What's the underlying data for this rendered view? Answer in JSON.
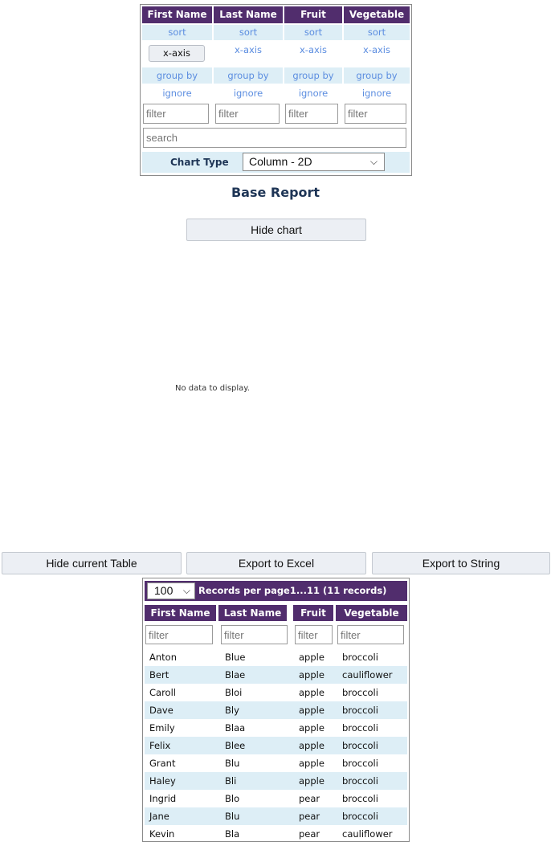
{
  "controls": {
    "columns": [
      "First Name",
      "Last Name",
      "Fruit",
      "Vegetable"
    ],
    "sort_label": "sort",
    "xaxis_label": "x-axis",
    "groupby_label": "group by",
    "ignore_label": "ignore",
    "filter_placeholder": "filter",
    "search_placeholder": "search",
    "chart_type_label": "Chart Type",
    "chart_type_value": "Column - 2D"
  },
  "report": {
    "title": "Base Report",
    "hide_chart_label": "Hide chart",
    "no_data_text": "No data to display."
  },
  "actions": {
    "hide_table_label": "Hide current Table",
    "export_excel_label": "Export to Excel",
    "export_string_label": "Export to String"
  },
  "table": {
    "page_size": "100",
    "pager_text": "Records per page1...11 (11 records)",
    "columns": [
      "First Name",
      "Last Name",
      "Fruit",
      "Vegetable"
    ],
    "filter_placeholder": "filter",
    "rows": [
      [
        "Anton",
        "Blue",
        "apple",
        "broccoli"
      ],
      [
        "Bert",
        "Blae",
        "apple",
        "cauliflower"
      ],
      [
        "Caroll",
        "Bloi",
        "apple",
        "broccoli"
      ],
      [
        "Dave",
        "Bly",
        "apple",
        "broccoli"
      ],
      [
        "Emily",
        "Blaa",
        "apple",
        "broccoli"
      ],
      [
        "Felix",
        "Blee",
        "apple",
        "broccoli"
      ],
      [
        "Grant",
        "Blu",
        "apple",
        "broccoli"
      ],
      [
        "Haley",
        "Bli",
        "apple",
        "broccoli"
      ],
      [
        "Ingrid",
        "Blo",
        "pear",
        "broccoli"
      ],
      [
        "Jane",
        "Blu",
        "pear",
        "broccoli"
      ],
      [
        "Kevin",
        "Bla",
        "pear",
        "cauliflower"
      ]
    ]
  },
  "colors": {
    "header_bg": "#512d6d",
    "row_alt_bg": "#ddeef6",
    "link_color": "#5b8de0",
    "title_color": "#1e3556"
  }
}
